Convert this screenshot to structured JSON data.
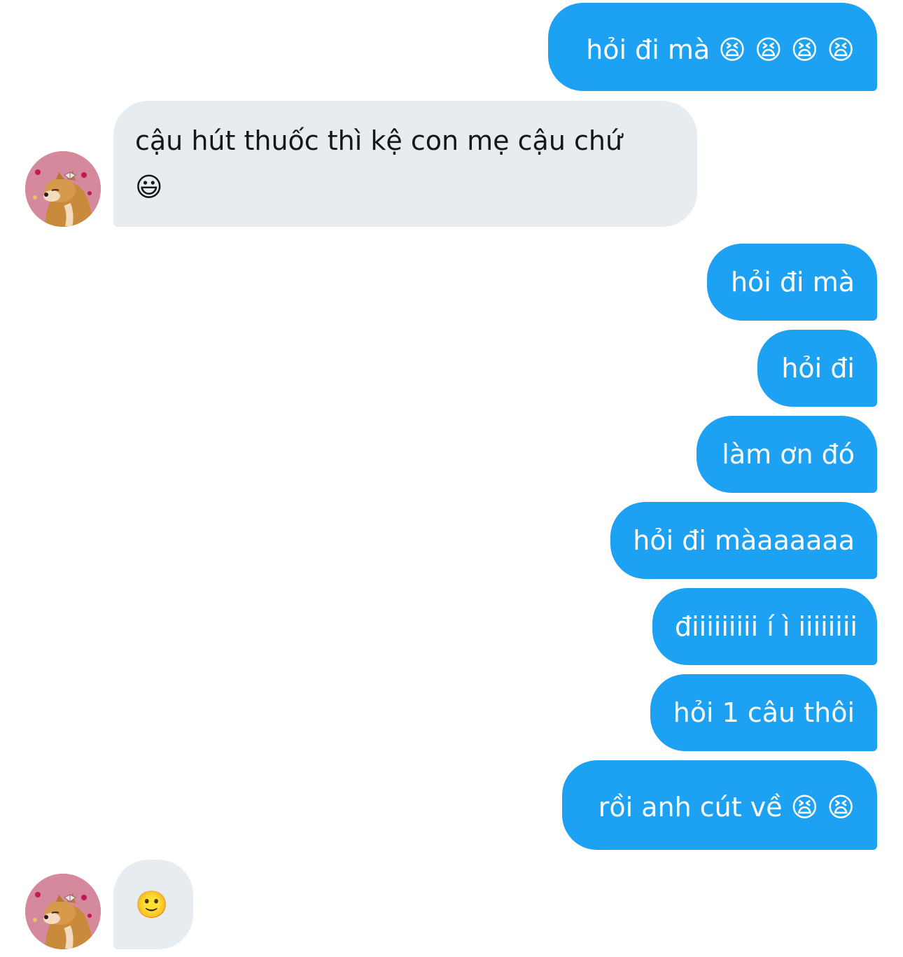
{
  "conversation": {
    "messages": [
      {
        "direction": "sent",
        "text": "hỏi đi mà 😫 😫 😫 😫"
      },
      {
        "direction": "received",
        "text": "cậu hút thuốc thì kệ con mẹ cậu chứ",
        "emoji": "😃"
      },
      {
        "direction": "sent",
        "text": "hỏi đi mà"
      },
      {
        "direction": "sent",
        "text": "hỏi đi"
      },
      {
        "direction": "sent",
        "text": "làm ơn đó"
      },
      {
        "direction": "sent",
        "text": "hỏi đi màaaaaaa"
      },
      {
        "direction": "sent",
        "text": "điiiiiiiii í ì iiiiiiii"
      },
      {
        "direction": "sent",
        "text": "hỏi 1 câu thôi"
      },
      {
        "direction": "sent",
        "text": "rồi anh cút về 😫 😫"
      },
      {
        "direction": "received",
        "text": "🙂"
      }
    ]
  },
  "avatar": {
    "icon": "shiba-dog-avatar-icon"
  },
  "colors": {
    "sent_bubble": "#1da1f2",
    "received_bubble": "#e6ecf0",
    "sent_text": "#ffffff",
    "received_text": "#14171a"
  }
}
